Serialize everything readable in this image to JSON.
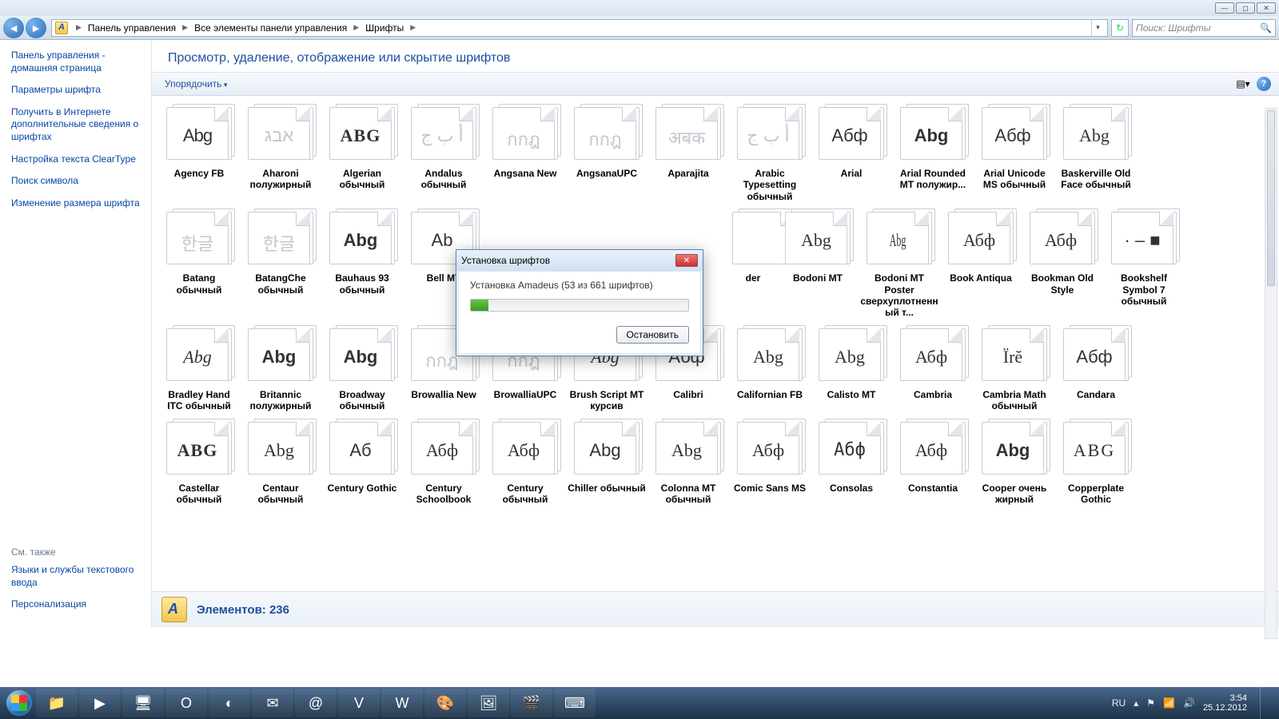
{
  "window": {
    "min": "—",
    "max": "◻",
    "close": "✕"
  },
  "nav": {
    "crumbs": [
      "Панель управления",
      "Все элементы панели управления",
      "Шрифты"
    ],
    "search_placeholder": "Поиск: Шрифты"
  },
  "sidebar": {
    "links": [
      "Панель управления - домашняя страница",
      "Параметры шрифта",
      "Получить в Интернете дополнительные сведения о шрифтах",
      "Настройка текста ClearType",
      "Поиск символа",
      "Изменение размера шрифта"
    ],
    "footer_label": "См. также",
    "footer_links": [
      "Языки и службы текстового ввода",
      "Персонализация"
    ]
  },
  "header": "Просмотр, удаление, отображение или скрытие шрифтов",
  "toolbar": {
    "organize": "Упорядочить"
  },
  "details": {
    "label": "Элементов: 236"
  },
  "dialog": {
    "title": "Установка шрифтов",
    "message": "Установка Amadeus (53 из 661 шрифтов)",
    "stop": "Остановить"
  },
  "fonts": [
    [
      {
        "n": "Agency FB",
        "s": "Abg",
        "st": "narrow"
      },
      {
        "n": "Aharoni полужирный",
        "s": "אבג",
        "dim": true
      },
      {
        "n": "Algerian обычный",
        "s": "ABG",
        "st": "serifcaps"
      },
      {
        "n": "Andalus обычный",
        "s": "أ ب ج",
        "dim": true
      },
      {
        "n": "Angsana New",
        "s": "กกฎ",
        "dim": true
      },
      {
        "n": "AngsanaUPC",
        "s": "กกฎ",
        "dim": true
      },
      {
        "n": "Aparajita",
        "s": "अबक",
        "dim": true
      },
      {
        "n": "Arabic Typesetting обычный",
        "s": "أ ب ج",
        "dim": true
      },
      {
        "n": "Arial",
        "s": "Абф"
      },
      {
        "n": "Arial Rounded MT полужир...",
        "s": "Abg",
        "st": "bold"
      },
      {
        "n": "Arial Unicode MS обычный",
        "s": "Абф"
      },
      {
        "n": "Baskerville Old Face обычный",
        "s": "Abg",
        "st": "serif"
      }
    ],
    [
      {
        "n": "Batang обычный",
        "s": "한글",
        "dim": true
      },
      {
        "n": "BatangChe обычный",
        "s": "한글",
        "dim": true
      },
      {
        "n": "Bauhaus 93 обычный",
        "s": "Abg",
        "st": "heavy"
      },
      {
        "n": "Bell MT",
        "s": "Ab",
        "cut": true
      },
      {
        "n": "",
        "s": "",
        "blank": true
      },
      {
        "n": "",
        "s": "",
        "blank": true
      },
      {
        "n": "",
        "s": "",
        "blank": true
      },
      {
        "n": "der",
        "s": "",
        "edge": true
      },
      {
        "n": "Bodoni MT",
        "s": "Abg",
        "st": "serif"
      },
      {
        "n": "Bodoni MT Poster сверхуплотненный т...",
        "s": "Abg",
        "st": "tall"
      },
      {
        "n": "Book Antiqua",
        "s": "Абф",
        "st": "serif"
      },
      {
        "n": "Bookman Old Style",
        "s": "Абф",
        "st": "serif"
      },
      {
        "n": "Bookshelf Symbol 7 обычный",
        "s": "· ‒ ■"
      }
    ],
    [
      {
        "n": "Bradley Hand ITC обычный",
        "s": "Abg",
        "st": "hand"
      },
      {
        "n": "Britannic полужирный",
        "s": "Abg",
        "st": "bold"
      },
      {
        "n": "Broadway обычный",
        "s": "Abg",
        "st": "heavy"
      },
      {
        "n": "Browallia New",
        "s": "กกฎ",
        "dim": true
      },
      {
        "n": "BrowalliaUPC",
        "s": "กกฎ",
        "dim": true
      },
      {
        "n": "Brush Script MT курсив",
        "s": "Abg",
        "st": "script"
      },
      {
        "n": "Calibri",
        "s": "Абф"
      },
      {
        "n": "Californian FB",
        "s": "Abg",
        "st": "serif"
      },
      {
        "n": "Calisto MT",
        "s": "Abg",
        "st": "serif"
      },
      {
        "n": "Cambria",
        "s": "Абф",
        "st": "serif"
      },
      {
        "n": "Cambria Math обычный",
        "s": "Ïrĕ",
        "st": "serif"
      },
      {
        "n": "Candara",
        "s": "Абф"
      }
    ],
    [
      {
        "n": "Castellar обычный",
        "s": "ABG",
        "st": "serifcaps"
      },
      {
        "n": "Centaur обычный",
        "s": "Abg",
        "st": "serif"
      },
      {
        "n": "Century Gothic",
        "s": "Аб"
      },
      {
        "n": "Century Schoolbook",
        "s": "Абф",
        "st": "serif"
      },
      {
        "n": "Century обычный",
        "s": "Абф",
        "st": "serif"
      },
      {
        "n": "Chiller обычный",
        "s": "Abg",
        "st": "thin"
      },
      {
        "n": "Colonna MT обычный",
        "s": "Abg",
        "st": "serif"
      },
      {
        "n": "Comic Sans MS",
        "s": "Абф",
        "st": "comic"
      },
      {
        "n": "Consolas",
        "s": "Абф",
        "st": "mono"
      },
      {
        "n": "Constantia",
        "s": "Абф",
        "st": "serif"
      },
      {
        "n": "Cooper очень жирный",
        "s": "Abg",
        "st": "black"
      },
      {
        "n": "Copperplate Gothic",
        "s": "ABG",
        "st": "smallcaps"
      }
    ]
  ],
  "taskbar": {
    "apps": [
      "📁",
      "▶",
      "🖥",
      "O",
      "◐",
      "✉",
      "@",
      "V",
      "W",
      "🎨",
      "🖼",
      "🎬",
      "⌨"
    ],
    "lang": "RU",
    "time": "3:54",
    "date": "25.12.2012"
  }
}
